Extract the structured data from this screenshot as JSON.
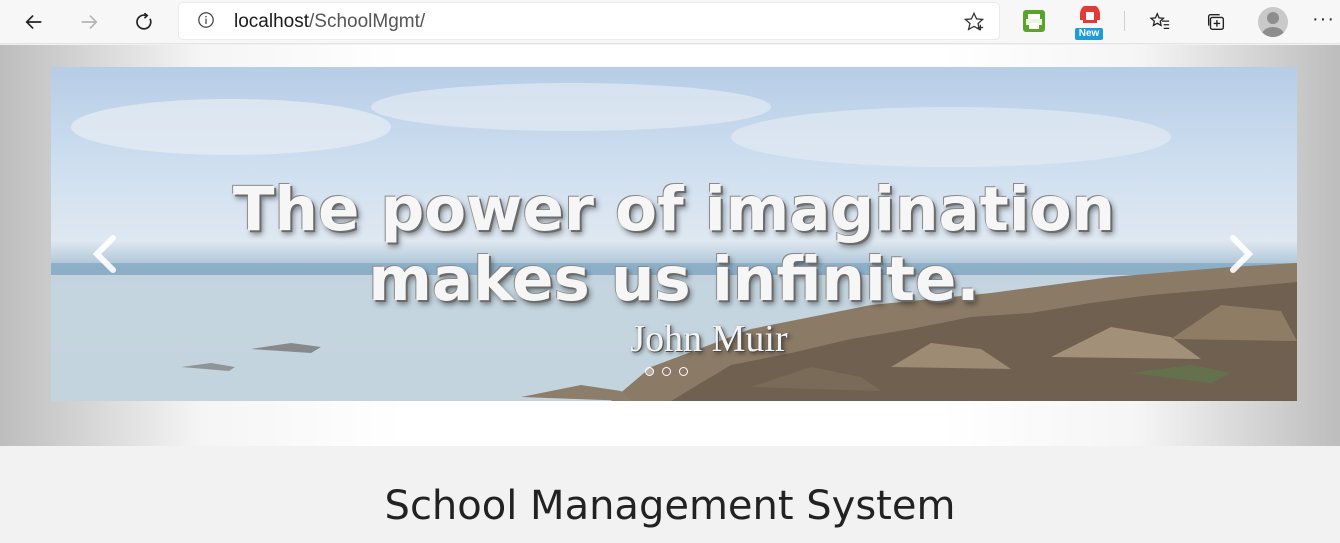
{
  "browser": {
    "url_host": "localhost",
    "url_path": "/SchoolMgmt/",
    "extension_badge": "New"
  },
  "carousel": {
    "quote_line1": "The power of imagination",
    "quote_line2": "makes us infinite.",
    "author": "John Muir",
    "slide_count": 3,
    "active_slide": 1
  },
  "page": {
    "title": "School Management System"
  },
  "icons": {
    "back": "back-arrow-icon",
    "forward": "forward-arrow-icon",
    "refresh": "refresh-icon",
    "info": "info-icon",
    "favorite": "star-icon",
    "extension_print": "print-extension-icon",
    "extension_new": "extension-icon",
    "favorites_list": "favorites-icon",
    "collections": "collections-icon",
    "profile": "avatar",
    "more": "more-icon",
    "prev": "chevron-left-icon",
    "next": "chevron-right-icon"
  }
}
